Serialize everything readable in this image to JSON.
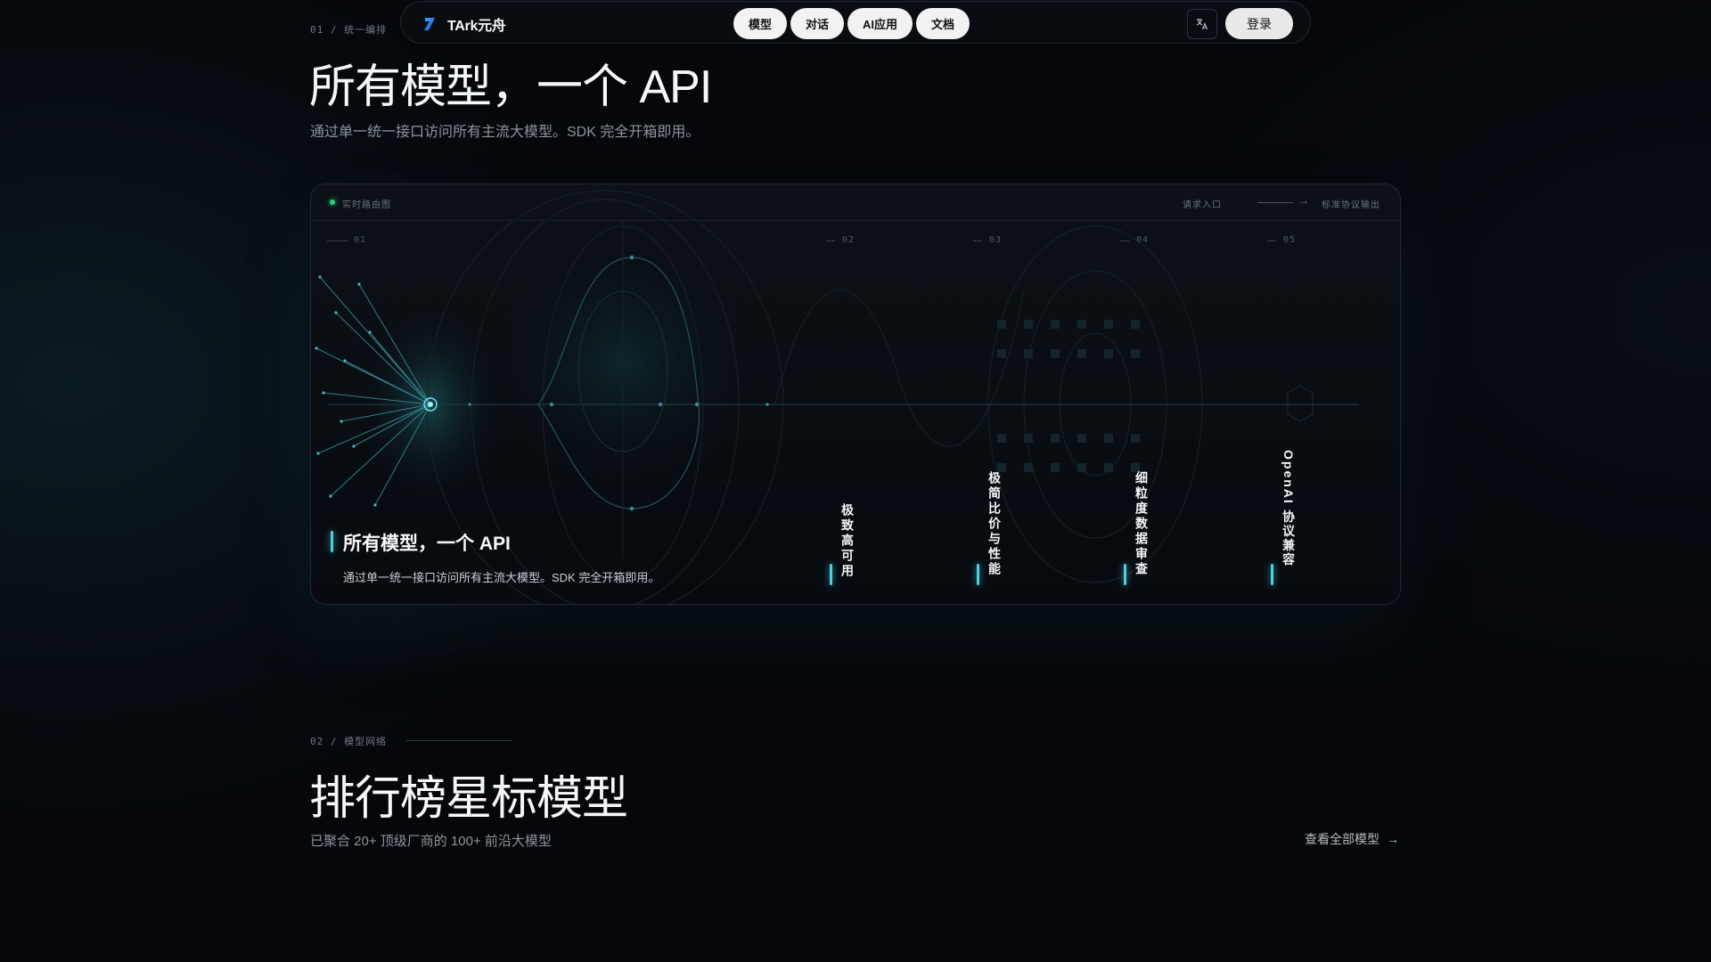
{
  "nav": {
    "brand": "TArk元舟",
    "items": [
      "模型",
      "对话",
      "AI应用",
      "文档"
    ],
    "lang_icon": "translate-icon",
    "login": "登录"
  },
  "section1": {
    "eyebrow": "01 / 统一编排",
    "title": "所有模型，一个 API",
    "subtitle": "通过单一统一接口访问所有主流大模型。SDK 完全开箱即用。"
  },
  "router": {
    "live_label": "实时路由图",
    "input_label": "请求入口",
    "output_label": "标准协议输出",
    "indices": [
      "01",
      "02",
      "03",
      "04",
      "05"
    ],
    "main_feature": {
      "title": "所有模型，一个 API",
      "desc": "通过单一统一接口访问所有主流大模型。SDK 完全开箱即用。"
    },
    "features": [
      "极致高可用",
      "极简比价与性能",
      "细粒度数据审查",
      "OpenAI 协议兼容"
    ],
    "accent": "#4fd1e0",
    "live_color": "#26d07c"
  },
  "section2": {
    "eyebrow": "02 / 模型网络",
    "title": "排行榜星标模型",
    "subtitle": "已聚合 20+ 顶级厂商的 100+ 前沿大模型",
    "view_all": "查看全部模型"
  }
}
